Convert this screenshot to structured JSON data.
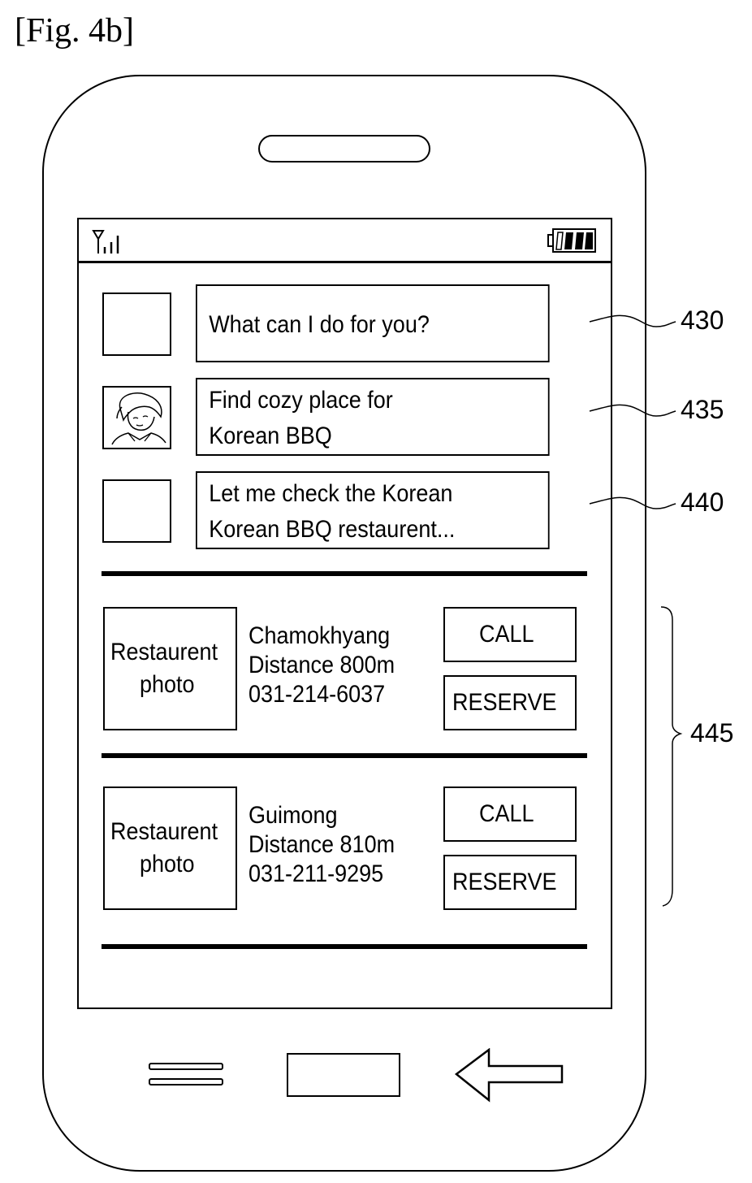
{
  "figure": {
    "title": "[Fig. 4b]"
  },
  "status_bar": {
    "signal_icon": "signal-antenna-icon",
    "battery_icon": "battery-icon"
  },
  "conversation": [
    {
      "speaker": "assistant",
      "avatar": "blank",
      "lines": [
        "What can I do for you?"
      ],
      "ref": "430"
    },
    {
      "speaker": "user",
      "avatar": "user-portrait",
      "lines": [
        "Find cozy place for",
        "Korean BBQ"
      ],
      "ref": "435"
    },
    {
      "speaker": "assistant",
      "avatar": "blank",
      "lines": [
        "Let me check the Korean",
        "Korean BBQ restaurent..."
      ],
      "ref": "440"
    }
  ],
  "results": {
    "ref": "445",
    "items": [
      {
        "photo_label": [
          "Restaurent",
          "photo"
        ],
        "name": "Chamokhyang",
        "distance": "Distance 800m",
        "phone": "031-214-6037",
        "call_label": "CALL",
        "reserve_label": "RESERVE"
      },
      {
        "photo_label": [
          "Restaurent",
          "photo"
        ],
        "name": "Guimong",
        "distance": "Distance 810m",
        "phone": "031-211-9295",
        "call_label": "CALL",
        "reserve_label": "RESERVE"
      }
    ]
  },
  "nav_bar": {
    "menu_icon": "menu-icon",
    "home_icon": "home-icon",
    "back_icon": "back-arrow-icon"
  }
}
